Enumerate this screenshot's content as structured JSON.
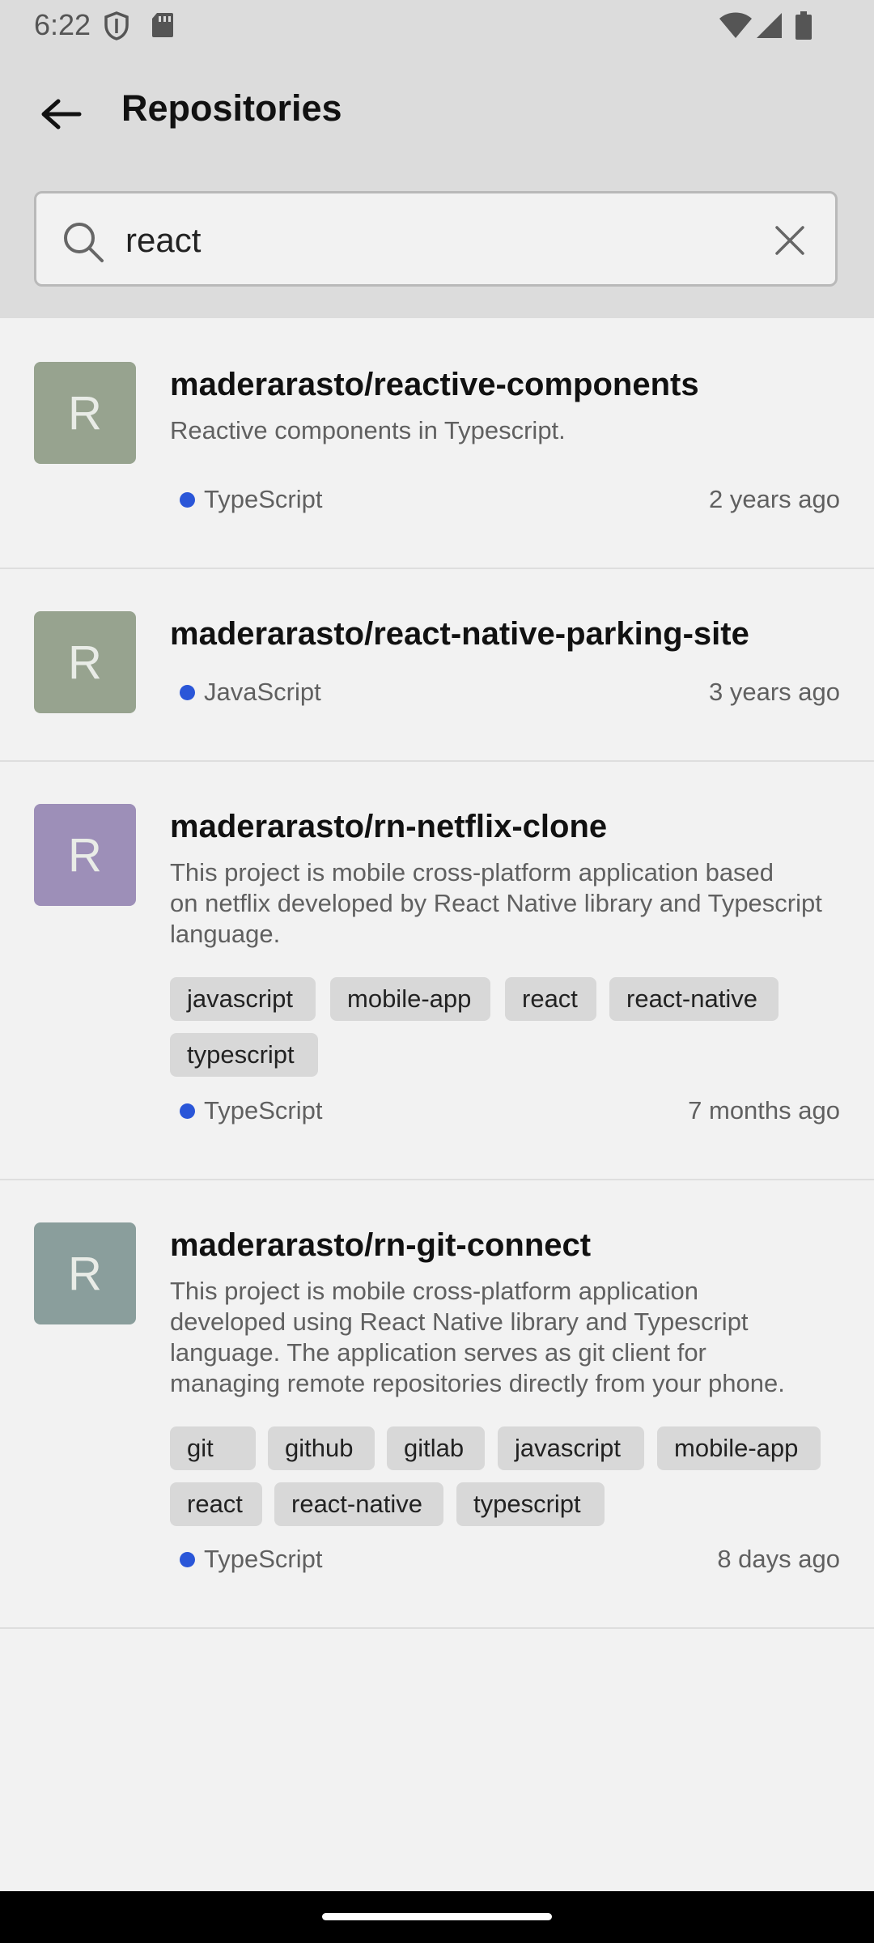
{
  "status_bar": {
    "time": "6:22"
  },
  "header": {
    "title": "Repositories"
  },
  "search": {
    "value": "react"
  },
  "repos": [
    {
      "avatar_letter": "R",
      "avatar_color": "#97a38f",
      "name": "maderarasto/reactive-components",
      "description": "Reactive components in Typescript.",
      "language": "TypeScript",
      "updated": "2 years ago",
      "topics": []
    },
    {
      "avatar_letter": "R",
      "avatar_color": "#97a38f",
      "name": "maderarasto/react-native-parking-site",
      "description": "",
      "language": "JavaScript",
      "updated": "3 years ago",
      "topics": []
    },
    {
      "avatar_letter": "R",
      "avatar_color": "#9d8fb8",
      "name": "maderarasto/rn-netflix-clone",
      "description_lines": [
        "This project is mobile cross-platform application based",
        "on netflix developed by React Native library and Typescript",
        "language."
      ],
      "language": "TypeScript",
      "updated": "7 months ago",
      "topics": [
        "javascript",
        "mobile-app",
        "react",
        "react-native",
        "typescript"
      ]
    },
    {
      "avatar_letter": "R",
      "avatar_color": "#8a9e9c",
      "name": "maderarasto/rn-git-connect",
      "description_lines": [
        "This project is mobile cross-platform application",
        "developed using React Native library and Typescript",
        "language. The application serves as git client for",
        "managing remote repositories directly from your phone."
      ],
      "language": "TypeScript",
      "updated": "8 days ago",
      "topics": [
        "git",
        "github",
        "gitlab",
        "javascript",
        "mobile-app",
        "react",
        "react-native",
        "typescript"
      ]
    }
  ],
  "colors": {
    "language_dot": "#2a56d8",
    "header_bg": "#dcdcdc",
    "page_bg": "#f2f2f2"
  }
}
